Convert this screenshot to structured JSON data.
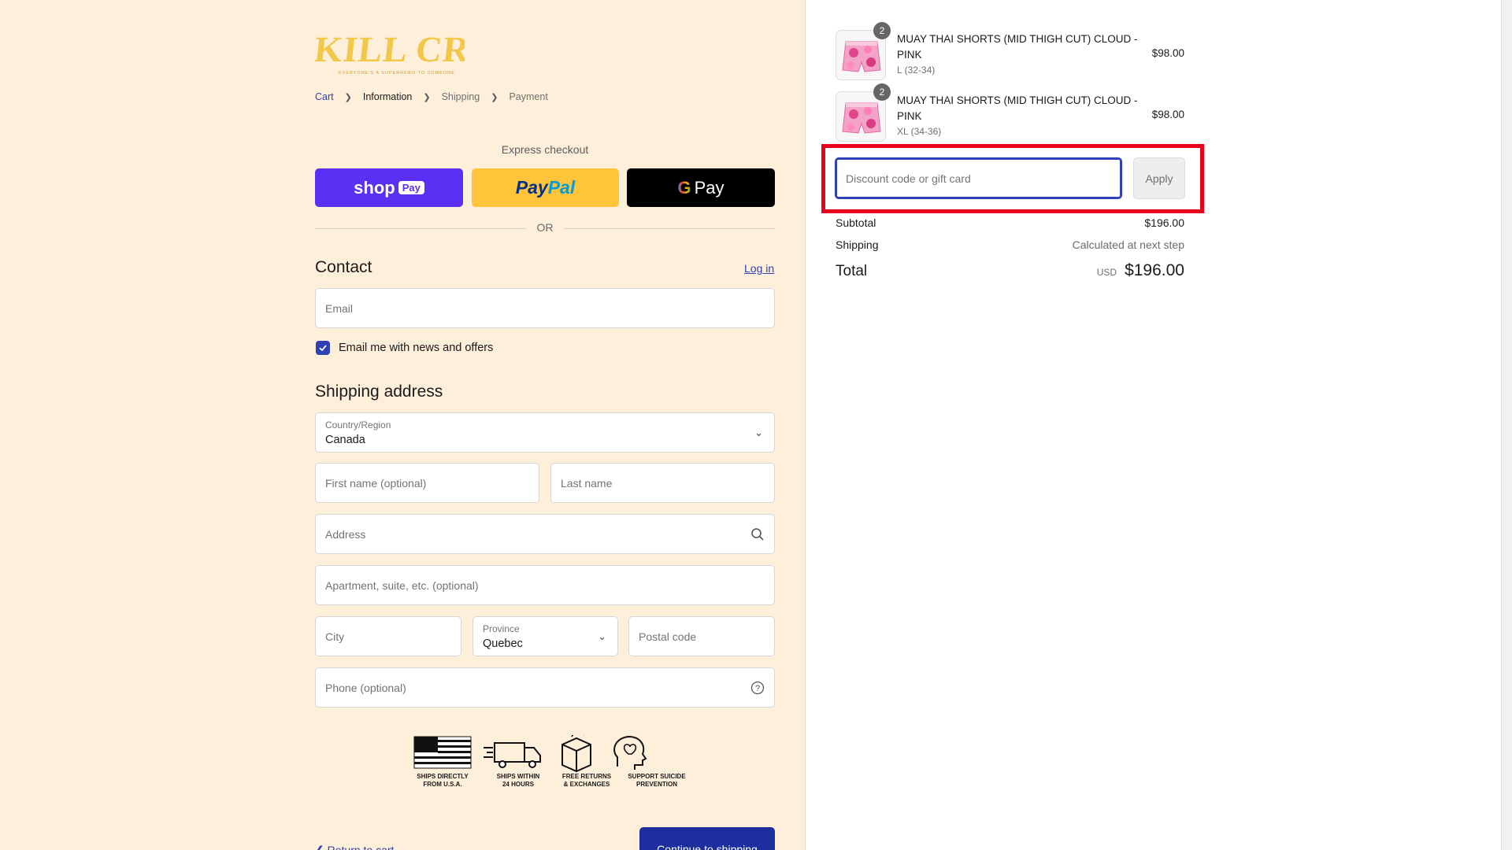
{
  "brand": {
    "logo_text": "KILL CREW",
    "tagline": "EVERYONE'S A SUPERHERO TO SOMEONE"
  },
  "breadcrumb": [
    {
      "label": "Cart",
      "state": "link"
    },
    {
      "label": "Information",
      "state": "current"
    },
    {
      "label": "Shipping",
      "state": "upcoming"
    },
    {
      "label": "Payment",
      "state": "upcoming"
    }
  ],
  "express": {
    "title": "Express checkout",
    "shop_pay": {
      "word": "shop",
      "pill": "Pay"
    },
    "paypal": {
      "part1": "Pay",
      "part2": "Pal"
    },
    "gpay": {
      "g": "G",
      "word": "Pay"
    },
    "or": "OR"
  },
  "contact": {
    "heading": "Contact",
    "login_link": "Log in",
    "email_placeholder": "Email",
    "newsletter_label": "Email me with news and offers",
    "newsletter_checked": true
  },
  "shipping": {
    "heading": "Shipping address",
    "country_label": "Country/Region",
    "country_value": "Canada",
    "first_name_placeholder": "First name (optional)",
    "last_name_placeholder": "Last name",
    "address_placeholder": "Address",
    "apartment_placeholder": "Apartment, suite, etc. (optional)",
    "city_placeholder": "City",
    "province_label": "Province",
    "province_value": "Quebec",
    "postal_placeholder": "Postal code",
    "phone_placeholder": "Phone (optional)"
  },
  "badges": [
    {
      "icon": "us-flag-icon",
      "line1": "SHIPS DIRECTLY",
      "line2": "FROM U.S.A."
    },
    {
      "icon": "truck-icon",
      "line1": "SHIPS WITHIN",
      "line2": "24 HOURS"
    },
    {
      "icon": "box-return-icon",
      "line1": "FREE RETURNS",
      "line2": "& EXCHANGES"
    },
    {
      "icon": "head-heart-icon",
      "line1": "SUPPORT SUICIDE",
      "line2": "PREVENTION"
    }
  ],
  "footer": {
    "continue_label": "Continue to shipping",
    "return_label": "Return to cart"
  },
  "order": {
    "items": [
      {
        "name": "MUAY THAI SHORTS (MID THIGH CUT) CLOUD - PINK",
        "variant": "L (32-34)",
        "quantity": "2",
        "price": "$98.00"
      },
      {
        "name": "MUAY THAI SHORTS (MID THIGH CUT) CLOUD - PINK",
        "variant": "XL (34-36)",
        "quantity": "2",
        "price": "$98.00"
      }
    ],
    "discount_placeholder": "Discount code or gift card",
    "apply_label": "Apply",
    "subtotal_label": "Subtotal",
    "subtotal_value": "$196.00",
    "shipping_label": "Shipping",
    "shipping_value": "Calculated at next step",
    "total_label": "Total",
    "currency": "USD",
    "total_value": "$196.00"
  },
  "colors": {
    "accent": "#2f3fb5",
    "highlight": "#e8001c",
    "panel_left": "#fdefd9",
    "shop_pay": "#5a31f4",
    "paypal": "#ffc439"
  }
}
